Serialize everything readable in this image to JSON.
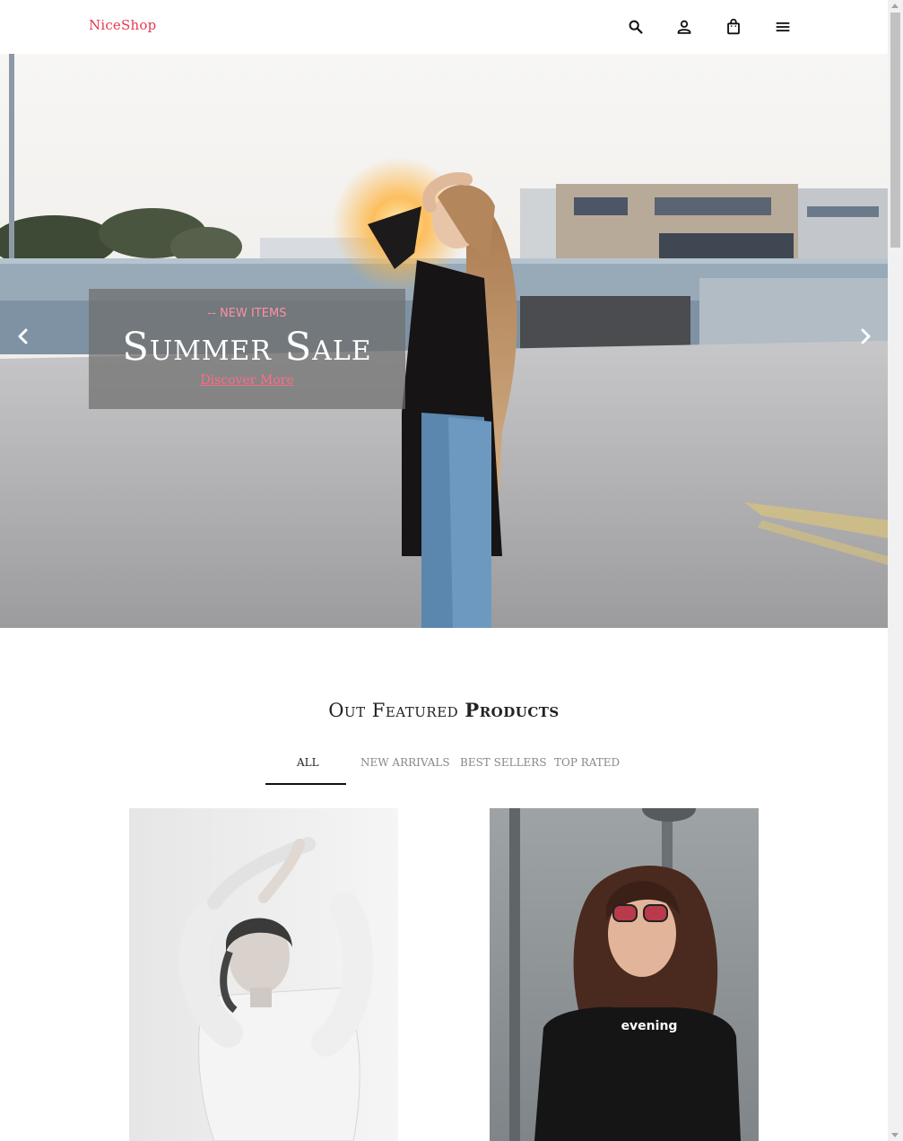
{
  "header": {
    "brand": "NiceShop",
    "icons": [
      "search-icon",
      "user-icon",
      "bag-icon",
      "menu-icon"
    ]
  },
  "hero": {
    "kicker": "-- NEW ITEMS",
    "title": "Summer Sale",
    "link": "Discover More",
    "arrows": [
      "chevron-left-icon",
      "chevron-right-icon"
    ]
  },
  "featured": {
    "title_light": "Out Featured",
    "title_bold": "Products",
    "tabs": [
      "ALL",
      "NEW ARRIVALS",
      "BEST SELLERS",
      "TOP RATED"
    ],
    "active_tab": "ALL"
  },
  "colors": {
    "brand": "#e8384f",
    "accent_pink": "#ff6b86",
    "text_dark": "#222222",
    "tab_muted": "#888888"
  }
}
